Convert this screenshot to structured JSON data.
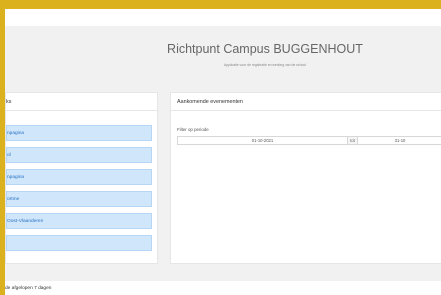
{
  "header": {
    "title": "Richtpunt Campus BUGGENHOUT",
    "subtitle": "Applicatie voor de registratie en werking van de school"
  },
  "left_panel": {
    "title": "ks",
    "links": [
      {
        "label": "npagina"
      },
      {
        "label": "ol"
      },
      {
        "label": "npagina"
      },
      {
        "label": "ortme"
      },
      {
        "label": "Oost-Vlaanderen"
      },
      {
        "label": ""
      }
    ]
  },
  "right_panel": {
    "title": "Aankomende evenementen",
    "filter_label": "Filter op periode",
    "date_from": "01-10-2021",
    "date_separator": "tot",
    "date_to": "31-10"
  },
  "bottom": {
    "label": "de afgelopen 7 dagen"
  },
  "colors": {
    "frame": "#dbb21e",
    "link_bg": "#cfe6fb",
    "link_text": "#2a73c2"
  }
}
